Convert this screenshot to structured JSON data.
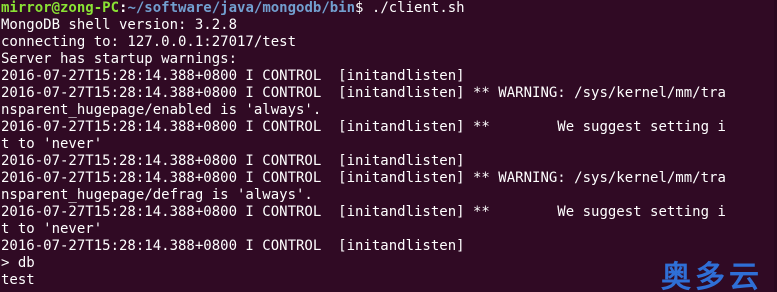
{
  "prompt": {
    "user_host": "mirror@zong-PC",
    "separator": ":",
    "path": "~/software/java/mongodb/bin",
    "symbol": "$",
    "command": " ./client.sh"
  },
  "output": {
    "shell_version": "MongoDB shell version: 3.2.8",
    "connecting": "connecting to: 127.0.0.1:27017/test",
    "startup_warnings": "Server has startup warnings: ",
    "log_lines": [
      "2016-07-27T15:28:14.388+0800 I CONTROL  [initandlisten] ",
      "2016-07-27T15:28:14.388+0800 I CONTROL  [initandlisten] ** WARNING: /sys/kernel/mm/tra",
      "nsparent_hugepage/enabled is 'always'.",
      "2016-07-27T15:28:14.388+0800 I CONTROL  [initandlisten] **        We suggest setting i",
      "t to 'never'",
      "2016-07-27T15:28:14.388+0800 I CONTROL  [initandlisten] ",
      "2016-07-27T15:28:14.388+0800 I CONTROL  [initandlisten] ** WARNING: /sys/kernel/mm/tra",
      "nsparent_hugepage/defrag is 'always'.",
      "2016-07-27T15:28:14.388+0800 I CONTROL  [initandlisten] **        We suggest setting i",
      "t to 'never'",
      "2016-07-27T15:28:14.388+0800 I CONTROL  [initandlisten] "
    ],
    "shell_input": "> db",
    "shell_result": "test"
  },
  "watermark": "奥多云",
  "colors": {
    "background": "#300a24",
    "prompt_user": "#8ae234",
    "prompt_path": "#729fcf",
    "text": "#ffffff",
    "watermark": "#2f6fd6"
  }
}
